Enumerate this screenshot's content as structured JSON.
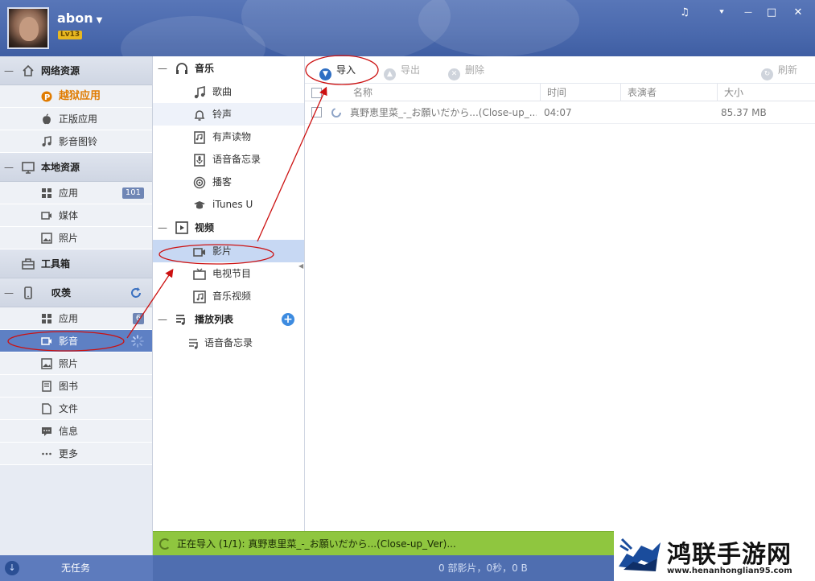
{
  "header": {
    "username": "abon",
    "level": "Lv13",
    "controls": {
      "music": "♫",
      "menu": "⯆",
      "minimize": "—",
      "maximize": "□",
      "close": "✕"
    }
  },
  "sidebar": {
    "online": {
      "title": "网络资源",
      "items": [
        {
          "label": "越狱应用"
        },
        {
          "label": "正版应用"
        },
        {
          "label": "影音图铃"
        }
      ]
    },
    "local": {
      "title": "本地资源",
      "items": [
        {
          "label": "应用",
          "badge": "101"
        },
        {
          "label": "媒体"
        },
        {
          "label": "照片"
        }
      ]
    },
    "toolbox": {
      "title": "工具箱"
    },
    "device": {
      "title": "叹羡",
      "items": [
        {
          "label": "应用",
          "badge": "6"
        },
        {
          "label": "影音"
        },
        {
          "label": "照片"
        },
        {
          "label": "图书"
        },
        {
          "label": "文件"
        },
        {
          "label": "信息"
        },
        {
          "label": "更多"
        }
      ]
    }
  },
  "middle": {
    "music": {
      "title": "音乐",
      "items": [
        {
          "label": "歌曲"
        },
        {
          "label": "铃声"
        },
        {
          "label": "有声读物"
        },
        {
          "label": "语音备忘录"
        },
        {
          "label": "播客"
        },
        {
          "label": "iTunes U"
        }
      ]
    },
    "video": {
      "title": "视频",
      "items": [
        {
          "label": "影片"
        },
        {
          "label": "电视节目"
        },
        {
          "label": "音乐视频"
        }
      ]
    },
    "playlist": {
      "title": "播放列表",
      "items": [
        {
          "label": "语音备忘录"
        }
      ]
    }
  },
  "toolbar": {
    "import": "导入",
    "export": "导出",
    "delete": "删除",
    "refresh": "刷新"
  },
  "table": {
    "columns": {
      "name": "名称",
      "time": "时间",
      "artist": "表演者",
      "size": "大小"
    },
    "rows": [
      {
        "name": "真野恵里菜_-_お願いだから...(Close-up_...",
        "time": "04:07",
        "artist": "",
        "size": "85.37 MB"
      }
    ]
  },
  "status": {
    "importing": "正在导入 (1/1): 真野恵里菜_-_お願いだから...(Close-up_Ver)...",
    "task": "无任务",
    "stats": "0 部影片，0秒，0 B"
  },
  "watermark": {
    "name": "鸿联手游网",
    "url": "www.henanhonglian95.com"
  },
  "colors": {
    "header": "#4a69ad",
    "selected": "#5e80c4",
    "accent": "#e07b00",
    "import_bar": "#8fc63f",
    "annotation": "#cc1111"
  }
}
